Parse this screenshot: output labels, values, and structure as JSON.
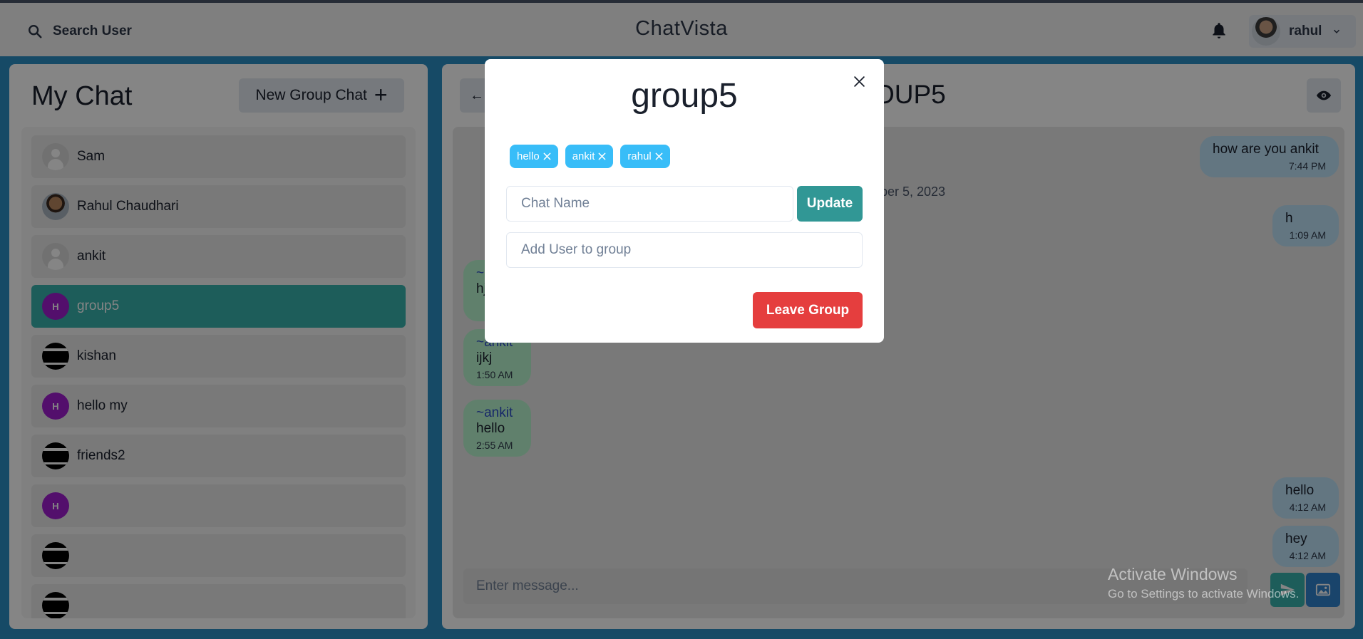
{
  "topbar": {
    "search_label": "Search User",
    "app_title": "ChatVista",
    "user_name": "rahul"
  },
  "sidebar": {
    "title": "My Chat",
    "new_group_label": "New Group Chat",
    "chats": [
      {
        "name": "Sam",
        "avatar": "default-user",
        "active": false
      },
      {
        "name": "Rahul Chaudhari",
        "avatar": "photo",
        "active": false
      },
      {
        "name": "ankit",
        "avatar": "default-user",
        "active": false
      },
      {
        "name": "group5",
        "avatar": "H",
        "active": true
      },
      {
        "name": "kishan",
        "avatar": "black-image",
        "active": false
      },
      {
        "name": "hello my",
        "avatar": "H",
        "active": false
      },
      {
        "name": "friends2",
        "avatar": "black-image",
        "active": false
      },
      {
        "name": "",
        "avatar": "H",
        "active": false
      },
      {
        "name": "",
        "avatar": "black-image",
        "active": false
      },
      {
        "name": "",
        "avatar": "black-image",
        "active": false
      }
    ]
  },
  "chat": {
    "title_visible": "OUP5",
    "date_separator": "ber 5, 2023",
    "messages": [
      {
        "side": "mine",
        "text": "how are you ankit",
        "time": "7:44 PM"
      },
      {
        "side": "mine",
        "text": "h",
        "time": "1:09 AM"
      },
      {
        "side": "theirs",
        "sender": "~",
        "text": "hj",
        "time": ""
      },
      {
        "side": "theirs",
        "sender": "~ankit",
        "text": "ijkj",
        "time": "1:50 AM"
      },
      {
        "side": "theirs",
        "sender": "~ankit",
        "text": "hello",
        "time": "2:55 AM"
      },
      {
        "side": "mine",
        "text": "hello",
        "time": "4:12 AM"
      },
      {
        "side": "mine",
        "text": "hey",
        "time": "4:12 AM"
      }
    ],
    "input_placeholder": "Enter message..."
  },
  "modal": {
    "title": "group5",
    "members": [
      "hello",
      "ankit",
      "rahul"
    ],
    "chat_name_placeholder": "Chat Name",
    "update_label": "Update",
    "add_user_placeholder": "Add User to group",
    "leave_label": "Leave Group"
  },
  "watermark": {
    "line1": "Activate Windows",
    "line2": "Go to Settings to activate Windows."
  },
  "colors": {
    "background": "#2b8fc4",
    "teal": "#38b2ac",
    "update": "#319795",
    "danger": "#e53e3e",
    "tag": "#38bdf8",
    "group_avatar": "#9f1dd0"
  }
}
